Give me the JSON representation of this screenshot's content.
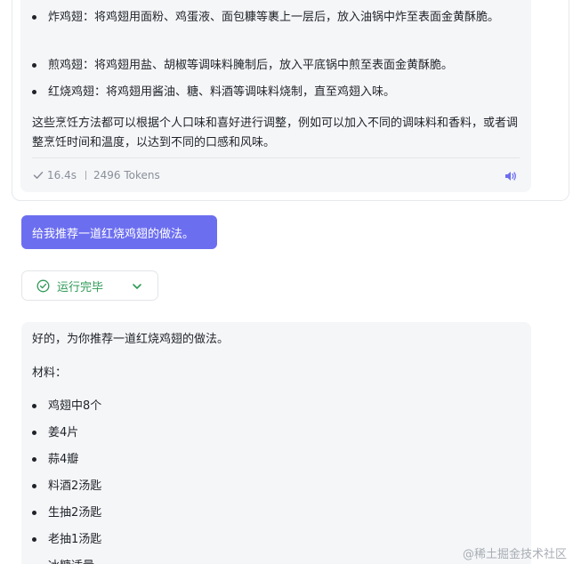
{
  "previous_answer": {
    "methods": [
      "炸鸡翅：将鸡翅用面粉、鸡蛋液、面包糠等裹上一层后，放入油锅中炸至表面金黄酥脆。",
      "煎鸡翅：将鸡翅用盐、胡椒等调味料腌制后，放入平底锅中煎至表面金黄酥脆。",
      "红烧鸡翅：将鸡翅用酱油、糖、料酒等调味料烧制，直至鸡翅入味。"
    ],
    "note": "这些烹饪方法都可以根据个人口味和喜好进行调整，例如可以加入不同的调味料和香料，或者调整烹饪时间和温度，以达到不同的口感和风味。",
    "meta": {
      "duration": "16.4s",
      "tokens": "2496 Tokens"
    },
    "icons": {
      "done": "check-icon",
      "speak": "speaker-icon"
    }
  },
  "user_message": "给我推荐一道红烧鸡翅的做法。",
  "status": {
    "label": "运行完毕",
    "color": "#2e9a57",
    "icons": {
      "state": "check-circle-icon",
      "toggle": "chevron-down-icon"
    }
  },
  "answer": {
    "intro": "好的，为你推荐一道红烧鸡翅的做法。",
    "materials_label": "材料：",
    "ingredients": [
      "鸡翅中8个",
      "姜4片",
      "蒜4瓣",
      "料酒2汤匙",
      "生抽2汤匙",
      "老抽1汤匙",
      "冰糖适量"
    ]
  },
  "watermark": "@稀土掘金技术社区",
  "colors": {
    "accent": "#6c6ef0",
    "bubble_bg": "#f5f6f8",
    "success": "#2e9a57",
    "muted_text": "#8a8f99"
  }
}
